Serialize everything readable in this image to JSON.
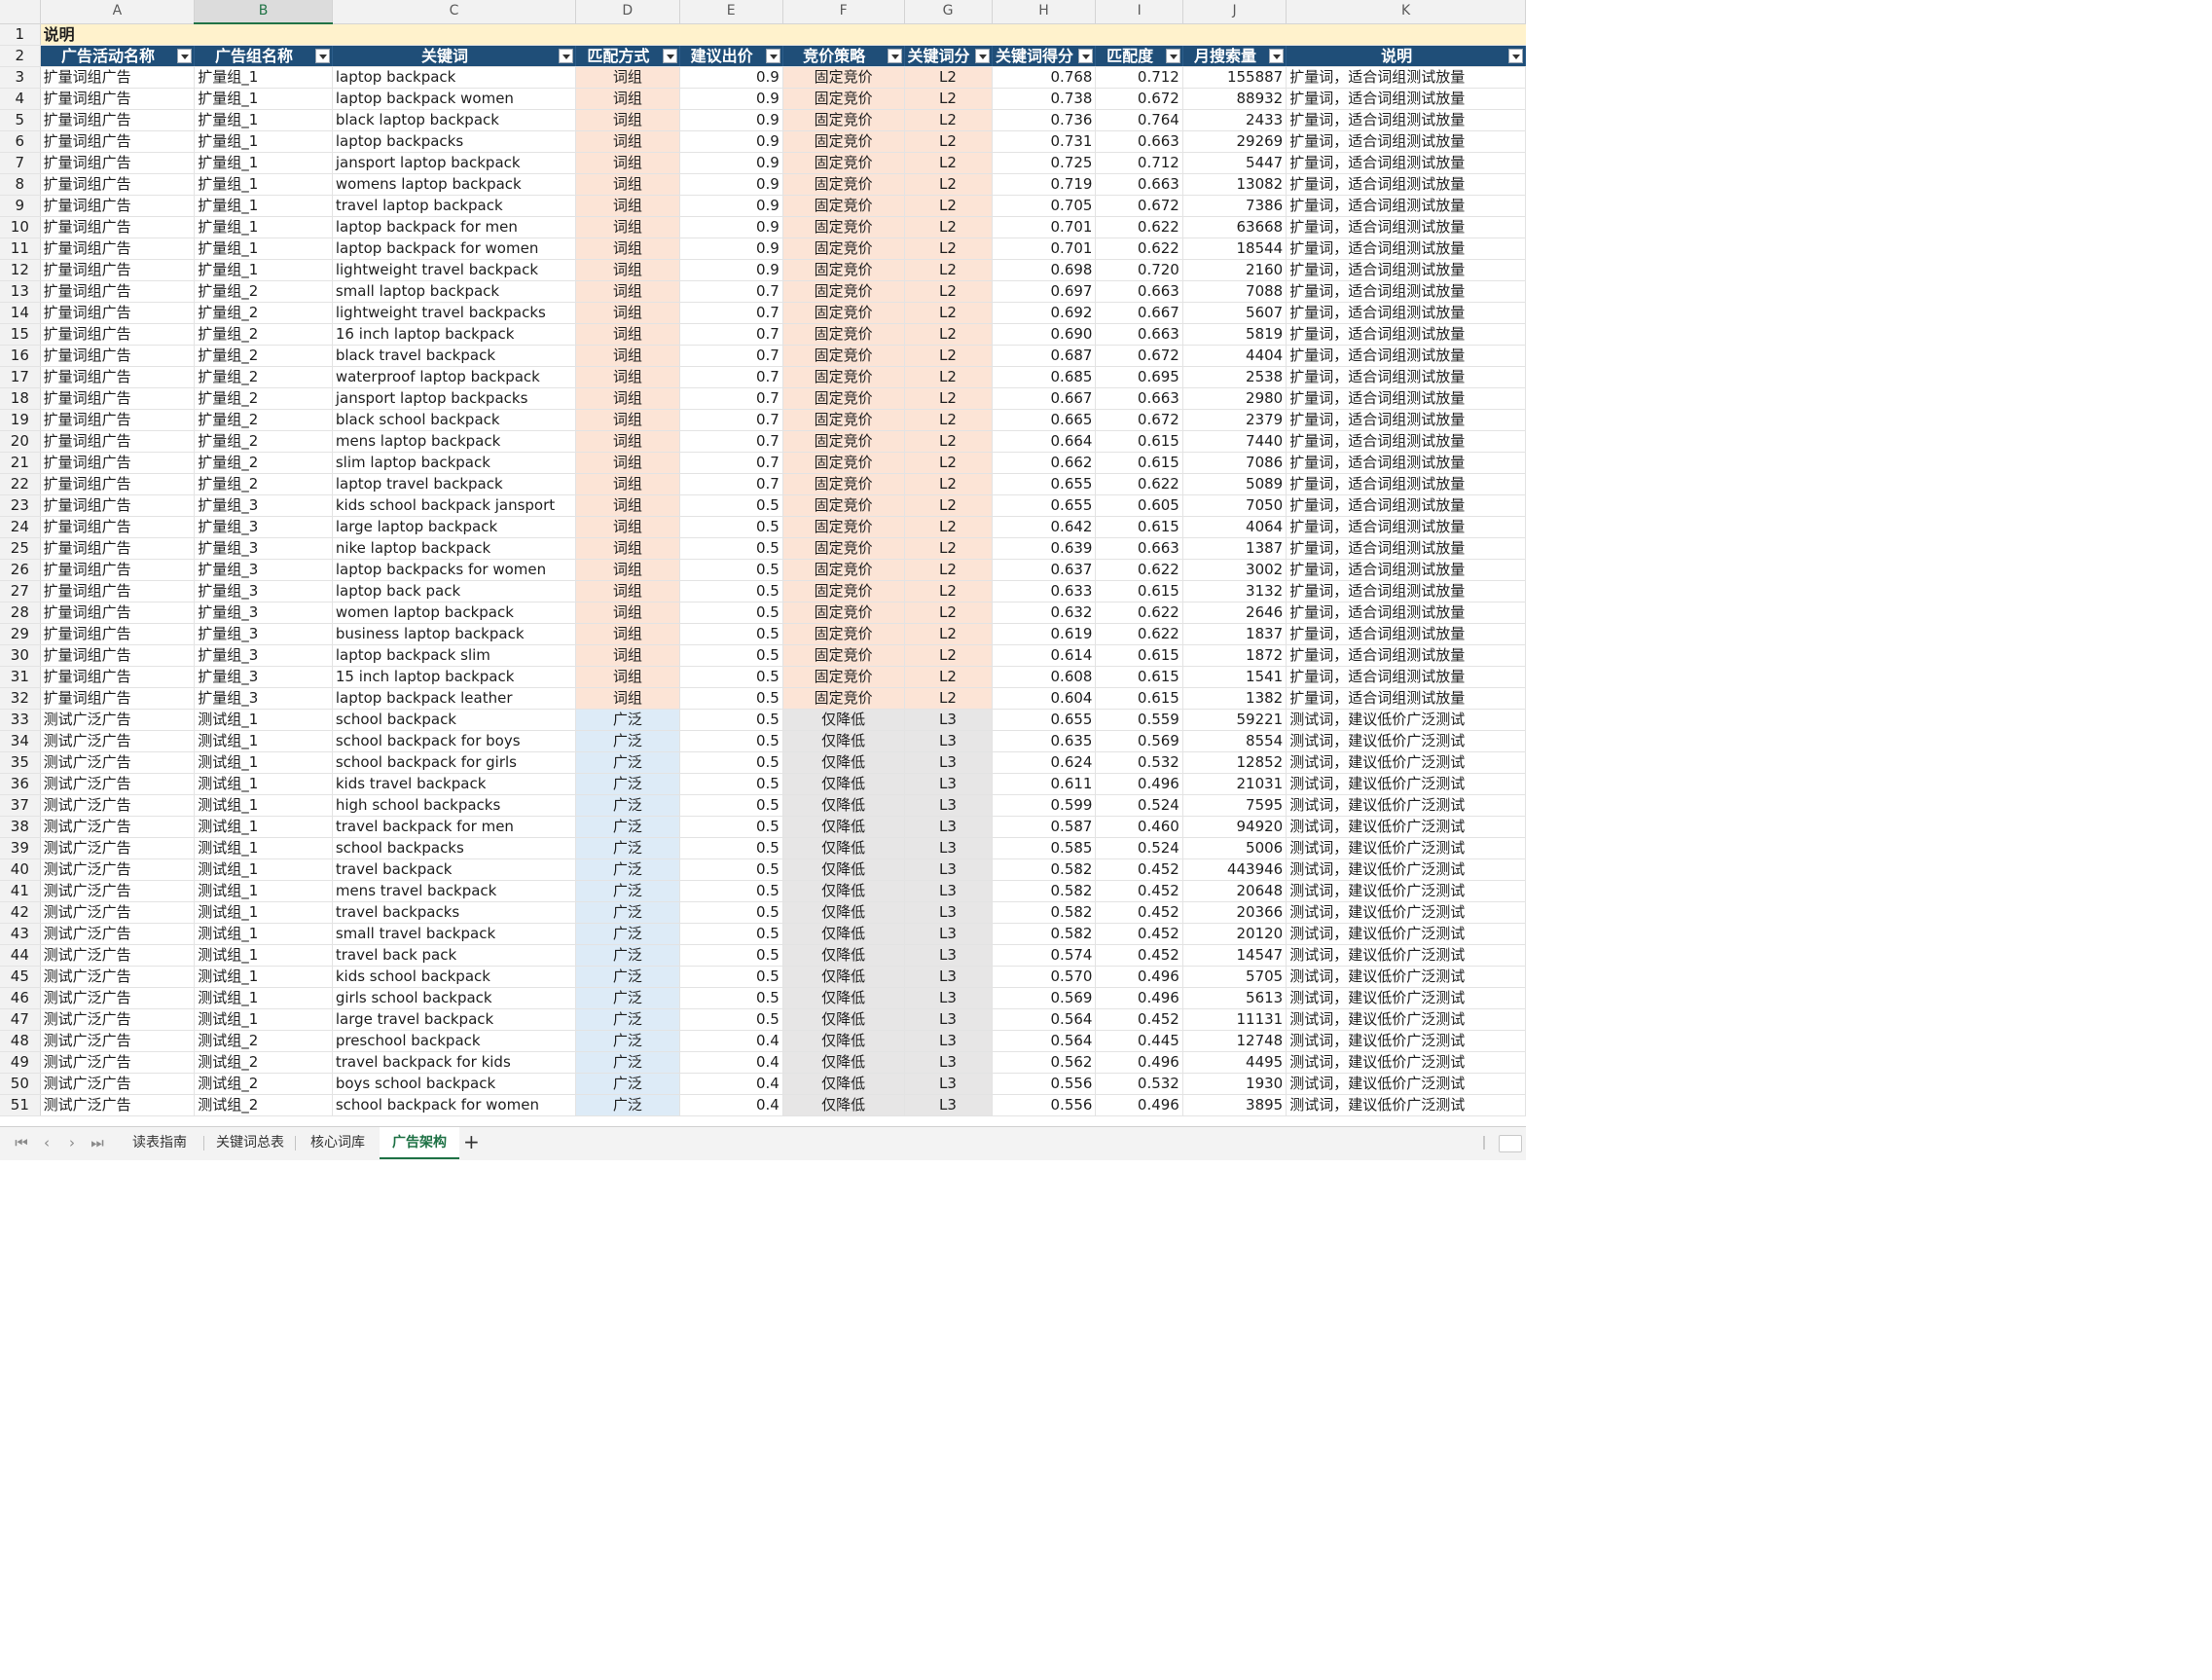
{
  "columns": [
    "A",
    "B",
    "C",
    "D",
    "E",
    "F",
    "G",
    "H",
    "I",
    "J",
    "K"
  ],
  "selected_column": "B",
  "note_row": {
    "row": 1,
    "text": "说明"
  },
  "header_row": {
    "row": 2,
    "labels": [
      "广告活动名称",
      "广告组名称",
      "关键词",
      "匹配方式",
      "建议出价",
      "竞价策略",
      "关键词分",
      "关键词得分",
      "匹配度",
      "月搜索量",
      "说明"
    ]
  },
  "first_data_row": 3,
  "fill_colors": {
    "header": "#1f4e78",
    "note": "#fff2cc",
    "phrase": "#fce4d6",
    "broad": "#ddebf7",
    "strategy_down": "#e7e6e6"
  },
  "rows": [
    [
      "扩量词组广告",
      "扩量组_1",
      "laptop backpack",
      "词组",
      "0.9",
      "固定竞价",
      "L2",
      "0.768",
      "0.712",
      "155887",
      "扩量词，适合词组测试放量"
    ],
    [
      "扩量词组广告",
      "扩量组_1",
      "laptop backpack women",
      "词组",
      "0.9",
      "固定竞价",
      "L2",
      "0.738",
      "0.672",
      "88932",
      "扩量词，适合词组测试放量"
    ],
    [
      "扩量词组广告",
      "扩量组_1",
      "black laptop backpack",
      "词组",
      "0.9",
      "固定竞价",
      "L2",
      "0.736",
      "0.764",
      "2433",
      "扩量词，适合词组测试放量"
    ],
    [
      "扩量词组广告",
      "扩量组_1",
      "laptop backpacks",
      "词组",
      "0.9",
      "固定竞价",
      "L2",
      "0.731",
      "0.663",
      "29269",
      "扩量词，适合词组测试放量"
    ],
    [
      "扩量词组广告",
      "扩量组_1",
      "jansport laptop backpack",
      "词组",
      "0.9",
      "固定竞价",
      "L2",
      "0.725",
      "0.712",
      "5447",
      "扩量词，适合词组测试放量"
    ],
    [
      "扩量词组广告",
      "扩量组_1",
      "womens laptop backpack",
      "词组",
      "0.9",
      "固定竞价",
      "L2",
      "0.719",
      "0.663",
      "13082",
      "扩量词，适合词组测试放量"
    ],
    [
      "扩量词组广告",
      "扩量组_1",
      "travel laptop backpack",
      "词组",
      "0.9",
      "固定竞价",
      "L2",
      "0.705",
      "0.672",
      "7386",
      "扩量词，适合词组测试放量"
    ],
    [
      "扩量词组广告",
      "扩量组_1",
      "laptop backpack for men",
      "词组",
      "0.9",
      "固定竞价",
      "L2",
      "0.701",
      "0.622",
      "63668",
      "扩量词，适合词组测试放量"
    ],
    [
      "扩量词组广告",
      "扩量组_1",
      "laptop backpack for women",
      "词组",
      "0.9",
      "固定竞价",
      "L2",
      "0.701",
      "0.622",
      "18544",
      "扩量词，适合词组测试放量"
    ],
    [
      "扩量词组广告",
      "扩量组_1",
      "lightweight travel backpack",
      "词组",
      "0.9",
      "固定竞价",
      "L2",
      "0.698",
      "0.720",
      "2160",
      "扩量词，适合词组测试放量"
    ],
    [
      "扩量词组广告",
      "扩量组_2",
      "small laptop backpack",
      "词组",
      "0.7",
      "固定竞价",
      "L2",
      "0.697",
      "0.663",
      "7088",
      "扩量词，适合词组测试放量"
    ],
    [
      "扩量词组广告",
      "扩量组_2",
      "lightweight travel backpacks",
      "词组",
      "0.7",
      "固定竞价",
      "L2",
      "0.692",
      "0.667",
      "5607",
      "扩量词，适合词组测试放量"
    ],
    [
      "扩量词组广告",
      "扩量组_2",
      "16 inch laptop backpack",
      "词组",
      "0.7",
      "固定竞价",
      "L2",
      "0.690",
      "0.663",
      "5819",
      "扩量词，适合词组测试放量"
    ],
    [
      "扩量词组广告",
      "扩量组_2",
      "black travel backpack",
      "词组",
      "0.7",
      "固定竞价",
      "L2",
      "0.687",
      "0.672",
      "4404",
      "扩量词，适合词组测试放量"
    ],
    [
      "扩量词组广告",
      "扩量组_2",
      "waterproof laptop backpack",
      "词组",
      "0.7",
      "固定竞价",
      "L2",
      "0.685",
      "0.695",
      "2538",
      "扩量词，适合词组测试放量"
    ],
    [
      "扩量词组广告",
      "扩量组_2",
      "jansport laptop backpacks",
      "词组",
      "0.7",
      "固定竞价",
      "L2",
      "0.667",
      "0.663",
      "2980",
      "扩量词，适合词组测试放量"
    ],
    [
      "扩量词组广告",
      "扩量组_2",
      "black school backpack",
      "词组",
      "0.7",
      "固定竞价",
      "L2",
      "0.665",
      "0.672",
      "2379",
      "扩量词，适合词组测试放量"
    ],
    [
      "扩量词组广告",
      "扩量组_2",
      "mens laptop backpack",
      "词组",
      "0.7",
      "固定竞价",
      "L2",
      "0.664",
      "0.615",
      "7440",
      "扩量词，适合词组测试放量"
    ],
    [
      "扩量词组广告",
      "扩量组_2",
      "slim laptop backpack",
      "词组",
      "0.7",
      "固定竞价",
      "L2",
      "0.662",
      "0.615",
      "7086",
      "扩量词，适合词组测试放量"
    ],
    [
      "扩量词组广告",
      "扩量组_2",
      "laptop travel backpack",
      "词组",
      "0.7",
      "固定竞价",
      "L2",
      "0.655",
      "0.622",
      "5089",
      "扩量词，适合词组测试放量"
    ],
    [
      "扩量词组广告",
      "扩量组_3",
      "kids school backpack jansport",
      "词组",
      "0.5",
      "固定竞价",
      "L2",
      "0.655",
      "0.605",
      "7050",
      "扩量词，适合词组测试放量"
    ],
    [
      "扩量词组广告",
      "扩量组_3",
      "large laptop backpack",
      "词组",
      "0.5",
      "固定竞价",
      "L2",
      "0.642",
      "0.615",
      "4064",
      "扩量词，适合词组测试放量"
    ],
    [
      "扩量词组广告",
      "扩量组_3",
      "nike laptop backpack",
      "词组",
      "0.5",
      "固定竞价",
      "L2",
      "0.639",
      "0.663",
      "1387",
      "扩量词，适合词组测试放量"
    ],
    [
      "扩量词组广告",
      "扩量组_3",
      "laptop backpacks for women",
      "词组",
      "0.5",
      "固定竞价",
      "L2",
      "0.637",
      "0.622",
      "3002",
      "扩量词，适合词组测试放量"
    ],
    [
      "扩量词组广告",
      "扩量组_3",
      "laptop back pack",
      "词组",
      "0.5",
      "固定竞价",
      "L2",
      "0.633",
      "0.615",
      "3132",
      "扩量词，适合词组测试放量"
    ],
    [
      "扩量词组广告",
      "扩量组_3",
      "women laptop backpack",
      "词组",
      "0.5",
      "固定竞价",
      "L2",
      "0.632",
      "0.622",
      "2646",
      "扩量词，适合词组测试放量"
    ],
    [
      "扩量词组广告",
      "扩量组_3",
      "business laptop backpack",
      "词组",
      "0.5",
      "固定竞价",
      "L2",
      "0.619",
      "0.622",
      "1837",
      "扩量词，适合词组测试放量"
    ],
    [
      "扩量词组广告",
      "扩量组_3",
      "laptop backpack slim",
      "词组",
      "0.5",
      "固定竞价",
      "L2",
      "0.614",
      "0.615",
      "1872",
      "扩量词，适合词组测试放量"
    ],
    [
      "扩量词组广告",
      "扩量组_3",
      "15 inch laptop backpack",
      "词组",
      "0.5",
      "固定竞价",
      "L2",
      "0.608",
      "0.615",
      "1541",
      "扩量词，适合词组测试放量"
    ],
    [
      "扩量词组广告",
      "扩量组_3",
      "laptop backpack leather",
      "词组",
      "0.5",
      "固定竞价",
      "L2",
      "0.604",
      "0.615",
      "1382",
      "扩量词，适合词组测试放量"
    ],
    [
      "测试广泛广告",
      "测试组_1",
      "school backpack",
      "广泛",
      "0.5",
      "仅降低",
      "L3",
      "0.655",
      "0.559",
      "59221",
      "测试词，建议低价广泛测试"
    ],
    [
      "测试广泛广告",
      "测试组_1",
      "school backpack for boys",
      "广泛",
      "0.5",
      "仅降低",
      "L3",
      "0.635",
      "0.569",
      "8554",
      "测试词，建议低价广泛测试"
    ],
    [
      "测试广泛广告",
      "测试组_1",
      "school backpack for girls",
      "广泛",
      "0.5",
      "仅降低",
      "L3",
      "0.624",
      "0.532",
      "12852",
      "测试词，建议低价广泛测试"
    ],
    [
      "测试广泛广告",
      "测试组_1",
      "kids travel backpack",
      "广泛",
      "0.5",
      "仅降低",
      "L3",
      "0.611",
      "0.496",
      "21031",
      "测试词，建议低价广泛测试"
    ],
    [
      "测试广泛广告",
      "测试组_1",
      "high school backpacks",
      "广泛",
      "0.5",
      "仅降低",
      "L3",
      "0.599",
      "0.524",
      "7595",
      "测试词，建议低价广泛测试"
    ],
    [
      "测试广泛广告",
      "测试组_1",
      "travel backpack for men",
      "广泛",
      "0.5",
      "仅降低",
      "L3",
      "0.587",
      "0.460",
      "94920",
      "测试词，建议低价广泛测试"
    ],
    [
      "测试广泛广告",
      "测试组_1",
      "school backpacks",
      "广泛",
      "0.5",
      "仅降低",
      "L3",
      "0.585",
      "0.524",
      "5006",
      "测试词，建议低价广泛测试"
    ],
    [
      "测试广泛广告",
      "测试组_1",
      "travel backpack",
      "广泛",
      "0.5",
      "仅降低",
      "L3",
      "0.582",
      "0.452",
      "443946",
      "测试词，建议低价广泛测试"
    ],
    [
      "测试广泛广告",
      "测试组_1",
      "mens travel backpack",
      "广泛",
      "0.5",
      "仅降低",
      "L3",
      "0.582",
      "0.452",
      "20648",
      "测试词，建议低价广泛测试"
    ],
    [
      "测试广泛广告",
      "测试组_1",
      "travel backpacks",
      "广泛",
      "0.5",
      "仅降低",
      "L3",
      "0.582",
      "0.452",
      "20366",
      "测试词，建议低价广泛测试"
    ],
    [
      "测试广泛广告",
      "测试组_1",
      "small travel backpack",
      "广泛",
      "0.5",
      "仅降低",
      "L3",
      "0.582",
      "0.452",
      "20120",
      "测试词，建议低价广泛测试"
    ],
    [
      "测试广泛广告",
      "测试组_1",
      "travel back pack",
      "广泛",
      "0.5",
      "仅降低",
      "L3",
      "0.574",
      "0.452",
      "14547",
      "测试词，建议低价广泛测试"
    ],
    [
      "测试广泛广告",
      "测试组_1",
      "kids school backpack",
      "广泛",
      "0.5",
      "仅降低",
      "L3",
      "0.570",
      "0.496",
      "5705",
      "测试词，建议低价广泛测试"
    ],
    [
      "测试广泛广告",
      "测试组_1",
      "girls school backpack",
      "广泛",
      "0.5",
      "仅降低",
      "L3",
      "0.569",
      "0.496",
      "5613",
      "测试词，建议低价广泛测试"
    ],
    [
      "测试广泛广告",
      "测试组_1",
      "large travel backpack",
      "广泛",
      "0.5",
      "仅降低",
      "L3",
      "0.564",
      "0.452",
      "11131",
      "测试词，建议低价广泛测试"
    ],
    [
      "测试广泛广告",
      "测试组_2",
      "preschool backpack",
      "广泛",
      "0.4",
      "仅降低",
      "L3",
      "0.564",
      "0.445",
      "12748",
      "测试词，建议低价广泛测试"
    ],
    [
      "测试广泛广告",
      "测试组_2",
      "travel backpack for kids",
      "广泛",
      "0.4",
      "仅降低",
      "L3",
      "0.562",
      "0.496",
      "4495",
      "测试词，建议低价广泛测试"
    ],
    [
      "测试广泛广告",
      "测试组_2",
      "boys school backpack",
      "广泛",
      "0.4",
      "仅降低",
      "L3",
      "0.556",
      "0.532",
      "1930",
      "测试词，建议低价广泛测试"
    ],
    [
      "测试广泛广告",
      "测试组_2",
      "school backpack for women",
      "广泛",
      "0.4",
      "仅降低",
      "L3",
      "0.556",
      "0.496",
      "3895",
      "测试词，建议低价广泛测试"
    ]
  ],
  "sheet_tabs": [
    {
      "label": "读表指南",
      "active": false
    },
    {
      "label": "关键词总表",
      "active": false
    },
    {
      "label": "核心词库",
      "active": false
    },
    {
      "label": "广告架构",
      "active": true
    }
  ],
  "tab_nav": {
    "first": "⏮",
    "prev": "‹",
    "next": "›",
    "last": "⏭",
    "add": "+"
  }
}
